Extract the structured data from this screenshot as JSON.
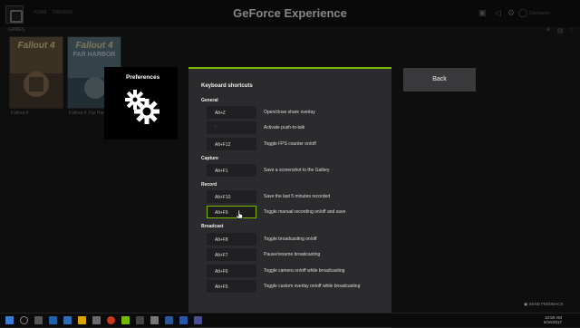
{
  "app": {
    "title": "GeForce Experience",
    "nav": [
      "HOME",
      "DRIVERS"
    ],
    "user_name": "Username",
    "icons": [
      "notifications-icon",
      "share-icon",
      "settings-icon",
      "user-icon"
    ]
  },
  "library": {
    "section_label": "GAMES",
    "games": [
      {
        "logo": "Fallout 4",
        "sub": "",
        "caption": "Fallout 4"
      },
      {
        "logo": "Fallout 4",
        "sub": "FAR HARBOR",
        "caption": "Fallout 4: Far Harbor"
      }
    ]
  },
  "preferences": {
    "title": "Preferences",
    "icon": "gears-icon"
  },
  "back_button": {
    "label": "Back"
  },
  "shortcuts": {
    "title": "Keyboard shortcuts",
    "sections": [
      {
        "title": "General",
        "rows": [
          {
            "key": "Alt+Z",
            "action": "Open/close share overlay"
          },
          {
            "key": "`",
            "action": "Activate push-to-talk"
          },
          {
            "key": "Alt+F12",
            "action": "Toggle FPS counter on/off"
          }
        ]
      },
      {
        "title": "Capture",
        "rows": [
          {
            "key": "Alt+F1",
            "action": "Save a screenshot to the Gallery"
          }
        ]
      },
      {
        "title": "Record",
        "rows": [
          {
            "key": "Alt+F10",
            "action": "Save the last 5 minutes recorded"
          },
          {
            "key": "Alt+F9",
            "action": "Toggle manual recording on/off and save",
            "active": true
          }
        ]
      },
      {
        "title": "Broadcast",
        "rows": [
          {
            "key": "Alt+F8",
            "action": "Toggle broadcasting on/off"
          },
          {
            "key": "Alt+F7",
            "action": "Pause/resume broadcasting"
          },
          {
            "key": "Alt+F6",
            "action": "Toggle camera on/off while broadcasting"
          },
          {
            "key": "Alt+F5",
            "action": "Toggle custom overlay on/off while broadcasting"
          }
        ]
      }
    ]
  },
  "feedback": {
    "label": "SEND FEEDBACK"
  },
  "taskbar": {
    "time": "10:50 AM",
    "date": "8/16/2017"
  },
  "colors": {
    "accent": "#76b900",
    "panel": "#2b2b2d",
    "keybox": "#202022",
    "button": "#3a3a3c"
  }
}
